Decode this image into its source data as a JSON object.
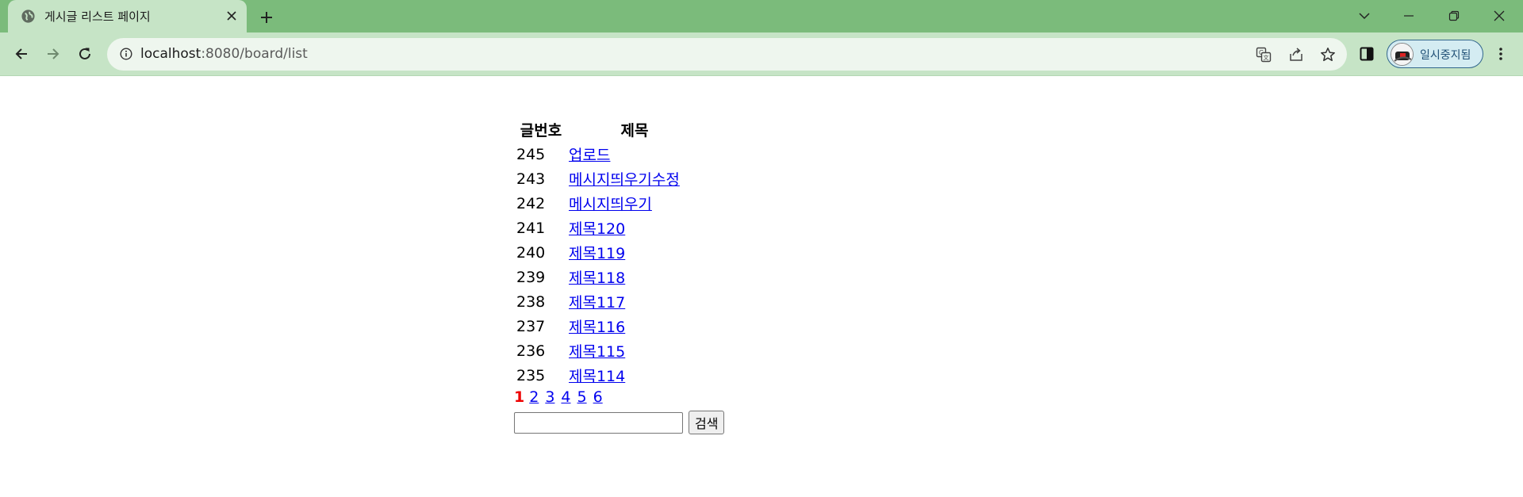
{
  "browser": {
    "tab": {
      "title": "게시글 리스트 페이지",
      "favicon": "globe-icon"
    },
    "address_bar": {
      "host": "localhost",
      "rest": ":8080/board/list"
    },
    "profile": {
      "label": "일시중지됨"
    },
    "colors": {
      "tabstrip": "#7bbb7b",
      "toolbar": "#c6e4c6",
      "omnibox": "#eef6ee"
    }
  },
  "board": {
    "headers": {
      "number": "글번호",
      "title": "제목"
    },
    "rows": [
      {
        "no": "245",
        "title": "업로드"
      },
      {
        "no": "243",
        "title": "메시지띄우기수정"
      },
      {
        "no": "242",
        "title": "메시지띄우기"
      },
      {
        "no": "241",
        "title": "제목120"
      },
      {
        "no": "240",
        "title": "제목119"
      },
      {
        "no": "239",
        "title": "제목118"
      },
      {
        "no": "238",
        "title": "제목117"
      },
      {
        "no": "237",
        "title": "제목116"
      },
      {
        "no": "236",
        "title": "제목115"
      },
      {
        "no": "235",
        "title": "제목114"
      }
    ]
  },
  "pagination": {
    "current": "1",
    "pages": [
      "2",
      "3",
      "4",
      "5",
      "6"
    ],
    "current_color": "#ee0000"
  },
  "search": {
    "input_value": "",
    "button_label": "검색"
  }
}
